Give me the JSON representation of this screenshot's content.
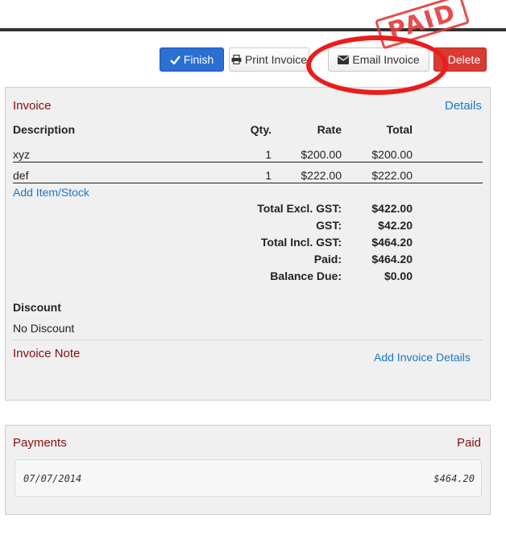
{
  "toolbar": {
    "finish_label": "Finish",
    "print_label": "Print Invoice",
    "email_label": "Email Invoice",
    "delete_label": "Delete"
  },
  "stamp": {
    "text": "PAID",
    "color": "#e23b3b"
  },
  "invoice": {
    "title": "Invoice",
    "details_link": "Details",
    "columns": {
      "description": "Description",
      "qty": "Qty.",
      "rate": "Rate",
      "total": "Total"
    },
    "items": [
      {
        "description": "xyz",
        "qty": "1",
        "rate": "$200.00",
        "total": "$200.00"
      },
      {
        "description": "def",
        "qty": "1",
        "rate": "$222.00",
        "total": "$222.00"
      }
    ],
    "add_item_link": "Add Item/Stock",
    "summary": [
      {
        "label": "Total Excl. GST:",
        "value": "$422.00"
      },
      {
        "label": "GST:",
        "value": "$42.20"
      },
      {
        "label": "Total Incl. GST:",
        "value": "$464.20"
      },
      {
        "label": "Paid:",
        "value": "$464.20"
      },
      {
        "label": "Balance Due:",
        "value": "$0.00"
      }
    ],
    "discount_heading": "Discount",
    "discount_value": "No Discount",
    "note_heading": "Invoice Note",
    "add_details_link": "Add Invoice Details"
  },
  "payments": {
    "title": "Payments",
    "status": "Paid",
    "entries": [
      {
        "date": "07/07/2014",
        "amount": "$464.20"
      }
    ]
  },
  "colors": {
    "accent_blue": "#2a6fd2",
    "danger_red": "#d73b33",
    "heading_red": "#8b0c0c",
    "link_blue": "#1a77c9",
    "annotation_red": "#ea1c1c"
  }
}
